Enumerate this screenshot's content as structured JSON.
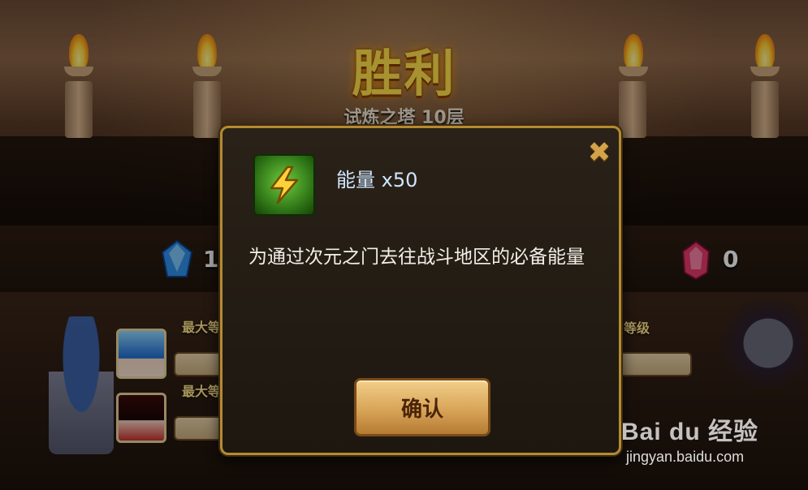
{
  "header": {
    "title": "胜利",
    "subtitle": "试炼之塔 10层"
  },
  "resources": {
    "left_value": "1",
    "right_value": "0"
  },
  "heroes": {
    "stat_label_1": "最大等",
    "stat_label_2": "最大等",
    "stat_label_right": "等级"
  },
  "dialog": {
    "item_name": "能量 x50",
    "item_description": "为通过次元之门去往战斗地区的必备能量",
    "confirm_label": "确认",
    "close_symbol": "✖",
    "item_icon": "lightning-icon"
  },
  "watermark": {
    "logo": "Bai du 经验",
    "url": "jingyan.baidu.com"
  },
  "colors": {
    "title": "#ffe04a",
    "dialog_border": "#b58a32",
    "confirm_button": "#d8a458",
    "item_name": "#cfe6ff"
  }
}
